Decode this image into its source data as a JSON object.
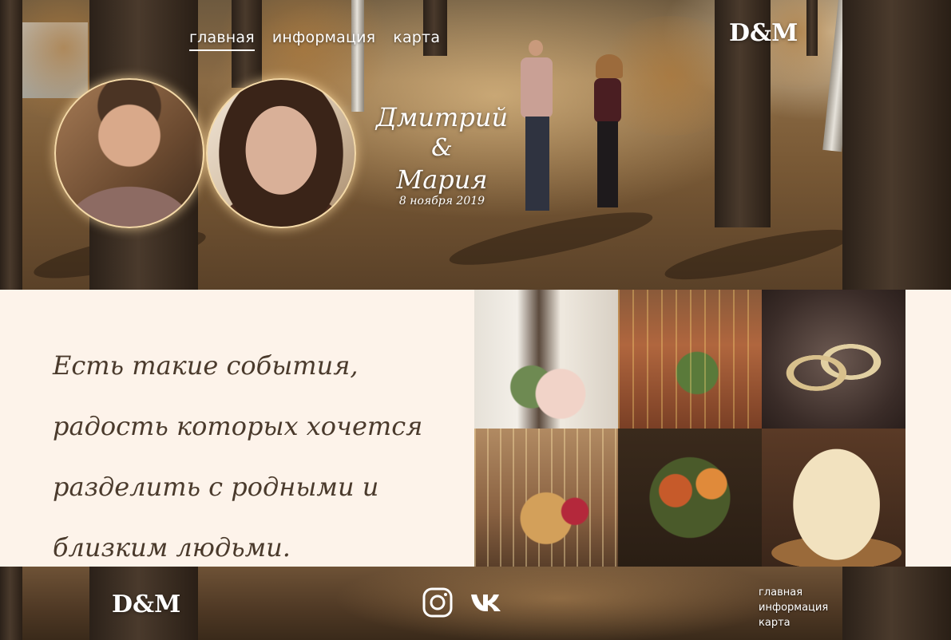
{
  "nav": {
    "items": [
      {
        "label": "главная",
        "active": true
      },
      {
        "label": "информация",
        "active": false
      },
      {
        "label": "карта",
        "active": false
      }
    ]
  },
  "brand": {
    "logo": "D&M"
  },
  "hero": {
    "groom_name": "Дмитрий",
    "ampersand": "&",
    "bride_name": "Мария",
    "date": "8 ноября 2019"
  },
  "intro": {
    "quote": "Есть такие события, радость которых хочется разделить с родными и близким людьми."
  },
  "gallery": {
    "tiles": [
      "table-decor-photo",
      "fairy-lights-wall-photo",
      "wedding-rings-photo",
      "heart-sign-photo",
      "autumn-bouquet-photo",
      "wedding-cake-photo"
    ]
  },
  "footer": {
    "logo": "D&M",
    "social": [
      "instagram-icon",
      "vk-icon"
    ],
    "links": [
      "главная",
      "информация",
      "карта"
    ]
  },
  "colors": {
    "cream": "#fdf3ea",
    "text_brown": "#4a3a2c",
    "white": "#ffffff",
    "portrait_glow": "#f4d9a7"
  }
}
